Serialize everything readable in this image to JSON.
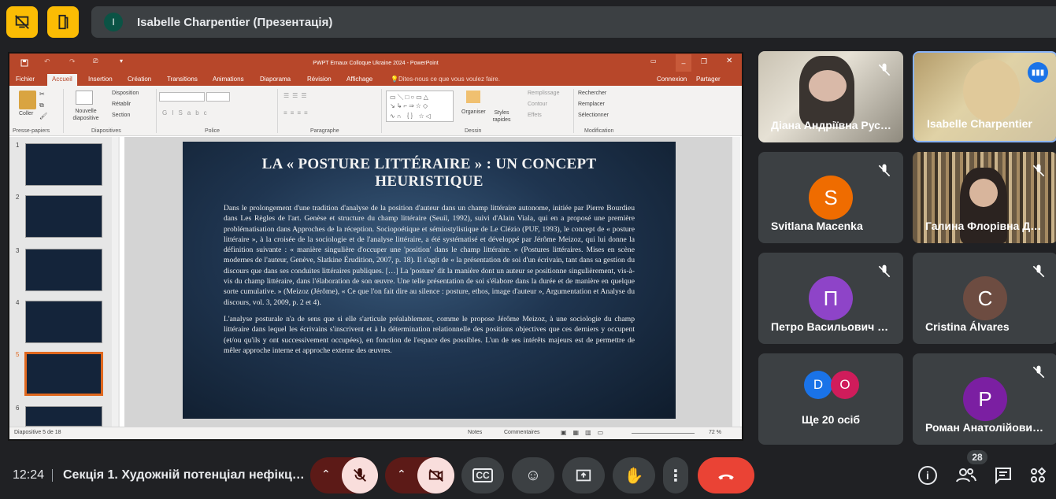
{
  "top": {
    "presenter_initial": "I",
    "presenter_label": "Isabelle Charpentier (Презентація)"
  },
  "ppt": {
    "window_title": "PWPT Ernaux Colloque Ukraine 2024 - PowerPoint",
    "tabs": [
      "Fichier",
      "Accueil",
      "Insertion",
      "Création",
      "Transitions",
      "Animations",
      "Diaporama",
      "Révision",
      "Affichage"
    ],
    "tell_me": "Dites-nous ce que vous voulez faire.",
    "connexion": "Connexion",
    "partager": "Partager",
    "ribbon": {
      "coller": "Coller",
      "presse_papiers": "Presse-papiers",
      "nouvelle_diapositive": "Nouvelle diapositive",
      "disposition": "Disposition",
      "retablir": "Rétablir",
      "section": "Section",
      "diapositives": "Diapositives",
      "police": "Police",
      "paragraphe": "Paragraphe",
      "organiser": "Organiser",
      "styles_rapides": "Styles rapides",
      "remplissage": "Remplissage",
      "contour": "Contour",
      "effets": "Effets",
      "dessin": "Dessin",
      "rechercher": "Rechercher",
      "remplacer": "Remplacer",
      "selectionner": "Sélectionner",
      "modification": "Modification"
    },
    "thumb_numbers": [
      "1",
      "2",
      "3",
      "4",
      "5",
      "6"
    ],
    "status": {
      "slide_of": "Diapositive 5 de 18",
      "notes": "Notes",
      "commentaires": "Commentaires",
      "zoom": "72 %"
    },
    "slide": {
      "title": "LA « POSTURE LITTÉRAIRE » : UN CONCEPT HEURISTIQUE",
      "para1": "Dans le prolongement d'une tradition d'analyse de la position d'auteur dans un champ littéraire autonome, initiée par Pierre Bourdieu dans Les Règles de l'art. Genèse et structure du champ littéraire (Seuil, 1992), suivi d'Alain Viala, qui en a proposé une première problématisation dans Approches de la réception. Sociopoétique et sémiostylistique de Le Clézio (PUF, 1993), le concept de « posture littéraire », à la croisée de la sociologie et de l'analyse littéraire, a été systématisé et développé par Jérôme Meizoz, qui lui donne la définition suivante : « manière singulière d'occuper une 'position' dans le champ littéraire. » (Postures littéraires. Mises en scène modernes de l'auteur, Genève, Slatkine Érudition, 2007, p. 18). Il s'agit de « la présentation de soi d'un écrivain, tant dans sa gestion du discours que dans ses conduites littéraires publiques. […] La 'posture' dit la manière dont un auteur se positionne singulièrement, vis-à-vis du champ littéraire, dans l'élaboration de son œuvre. Une telle présentation de soi s'élabore dans la durée et de manière en quelque sorte cumulative. » (Meizoz (Jérôme), « Ce que l'on fait dire au silence : posture, ethos, image d'auteur », Argumentation et Analyse du discours, vol. 3, 2009, p. 2 et 4).",
      "para2": "L'analyse posturale n'a de sens que si elle s'articule préalablement, comme le propose Jérôme Meizoz, à une sociologie du champ littéraire dans lequel les écrivains s'inscrivent et à la détermination relationnelle des positions objectives que ces derniers y occupent (et/ou qu'ils y ont successivement occupées), en fonction de l'espace des possibles. L'un de ses intérêts majeurs est de permettre de mêler approche interne et approche externe des œuvres."
    }
  },
  "tiles": {
    "t1": "Діана Андріївна Рус…",
    "t2": "Isabelle Charpentier",
    "t3": "Svitlana Macenka",
    "t3_initial": "S",
    "t4": "Галина Флорівна Др…",
    "t5": "Петро Васильович Р…",
    "t5_initial": "П",
    "t6": "Cristina Álvares",
    "t6_initial": "C",
    "t7": "Ще 20 осіб",
    "t7_a": "D",
    "t7_b": "O",
    "t8": "Роман Анатолійович…",
    "t8_initial": "P"
  },
  "bottom": {
    "time": "12:24",
    "meeting": "Секція 1. Художній потенціал нефікц…",
    "participants_count": "28"
  },
  "colors": {
    "accent_yellow": "#fbbc04",
    "end_call": "#ea4335",
    "mic_off": "#f9dedc",
    "ppt_red": "#b7472a"
  }
}
